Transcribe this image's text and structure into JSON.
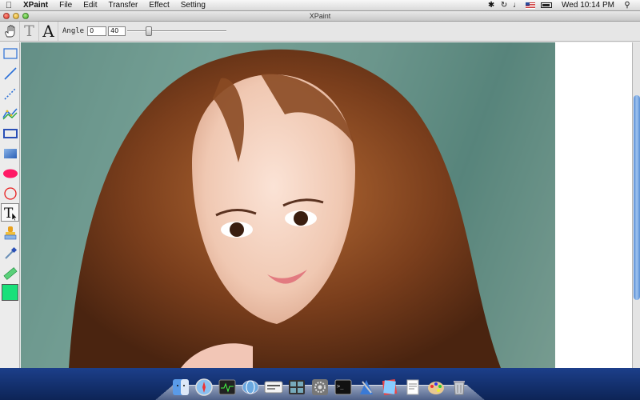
{
  "menubar": {
    "apple": "",
    "app_name": "XPaint",
    "menus": [
      "File",
      "Edit",
      "Transfer",
      "Effect",
      "Setting"
    ],
    "clock": "Wed 10:14 PM"
  },
  "window": {
    "title": "XPaint"
  },
  "toolbar": {
    "angle_label": "Angle",
    "angle_value": "0",
    "size_value": "40",
    "slider_level": 0.2
  },
  "tools": [
    "rectangle-select",
    "line",
    "dotted-line",
    "polyline",
    "rectangle",
    "gradient-fill",
    "filled-ellipse",
    "ellipse",
    "text",
    "stamp",
    "eyedropper",
    "ruler",
    "color-swatch"
  ],
  "colors": {
    "accent_green": "#18e07a",
    "tool_blue": "#2a6fd6",
    "ellipse_fill": "#ff1a66",
    "ellipse_stroke": "#e81e1e"
  }
}
